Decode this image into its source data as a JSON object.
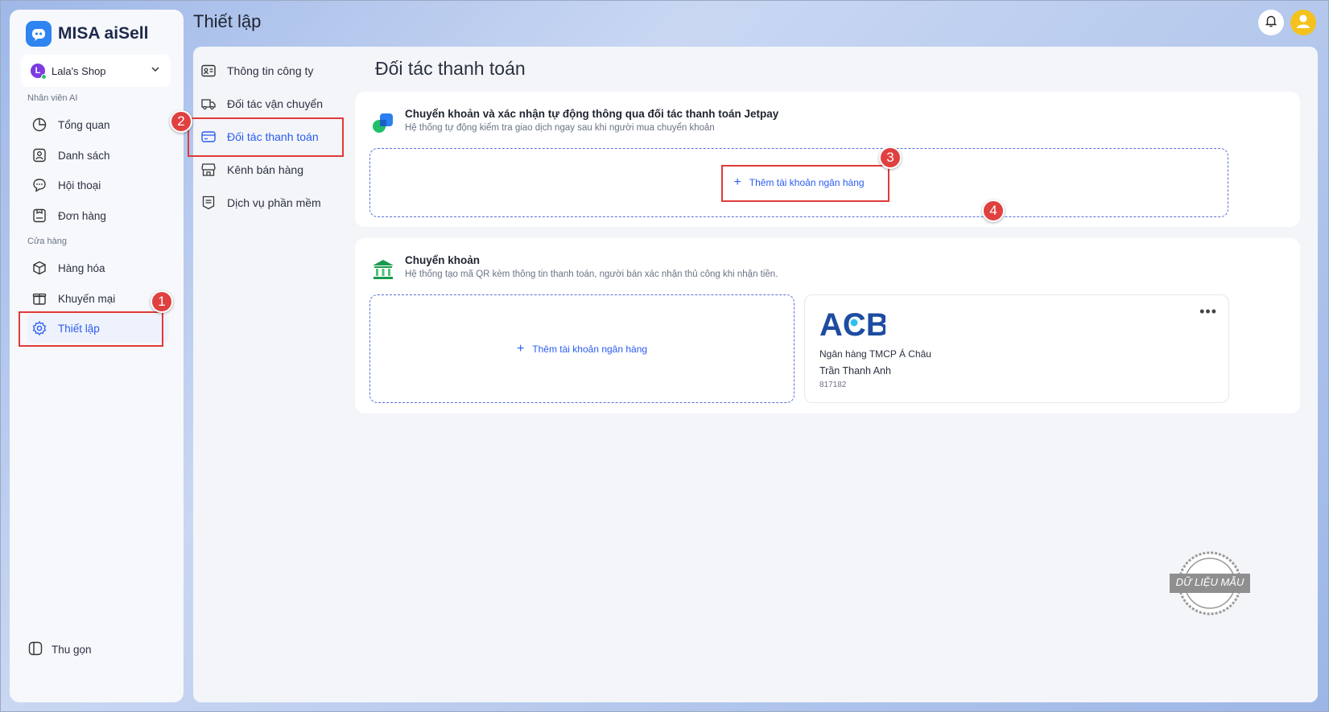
{
  "brand": {
    "name": "MISA aiSell"
  },
  "shop": {
    "name": "Lala's Shop",
    "avatar_letter": "L"
  },
  "sidebar": {
    "section_ai": "Nhân viên AI",
    "section_store": "Cửa hàng",
    "items": [
      {
        "label": "Tổng quan",
        "icon": "pie-chart-icon"
      },
      {
        "label": "Danh sách",
        "icon": "contact-list-icon"
      },
      {
        "label": "Hội thoại",
        "icon": "chat-icon"
      },
      {
        "label": "Đơn hàng",
        "icon": "order-icon"
      },
      {
        "label": "Hàng hóa",
        "icon": "box-icon"
      },
      {
        "label": "Khuyến mại",
        "icon": "gift-icon"
      },
      {
        "label": "Thiết lập",
        "icon": "gear-icon"
      }
    ],
    "collapse_label": "Thu gọn"
  },
  "header": {
    "title": "Thiết lập"
  },
  "subnav": {
    "items": [
      {
        "label": "Thông tin công ty",
        "icon": "id-card-icon"
      },
      {
        "label": "Đối tác vận chuyển",
        "icon": "truck-icon"
      },
      {
        "label": "Đối tác thanh toán",
        "icon": "card-icon"
      },
      {
        "label": "Kênh bán hàng",
        "icon": "store-icon"
      },
      {
        "label": "Dịch vụ phần mềm",
        "icon": "document-icon"
      }
    ]
  },
  "content": {
    "title": "Đối tác thanh toán",
    "jetpay": {
      "title": "Chuyển khoản và xác nhận tự động thông qua đối tác thanh toán Jetpay",
      "desc": "Hệ thống tự động kiểm tra giao dịch ngay sau khi người mua chuyển khoản",
      "add_label": "Thêm tài khoản ngân hàng"
    },
    "transfer": {
      "title": "Chuyển khoản",
      "desc": "Hệ thống tạo mã QR kèm thông tin thanh toán, người bán xác nhận thủ công khi nhận tiền.",
      "add_label": "Thêm tài khoản ngân hàng"
    },
    "bank": {
      "logo_text": "ACB",
      "name": "Ngân hàng TMCP Á Châu",
      "owner": "Trần Thanh Anh",
      "number": "817182",
      "more": "•••"
    }
  },
  "annotations": [
    "1",
    "2",
    "3",
    "4"
  ],
  "stamp": {
    "text": "DỮ LIỆU MẪU"
  },
  "colors": {
    "accent": "#2a5cf0",
    "annotation": "#e03a3a",
    "acb": "#1e4ca1"
  }
}
